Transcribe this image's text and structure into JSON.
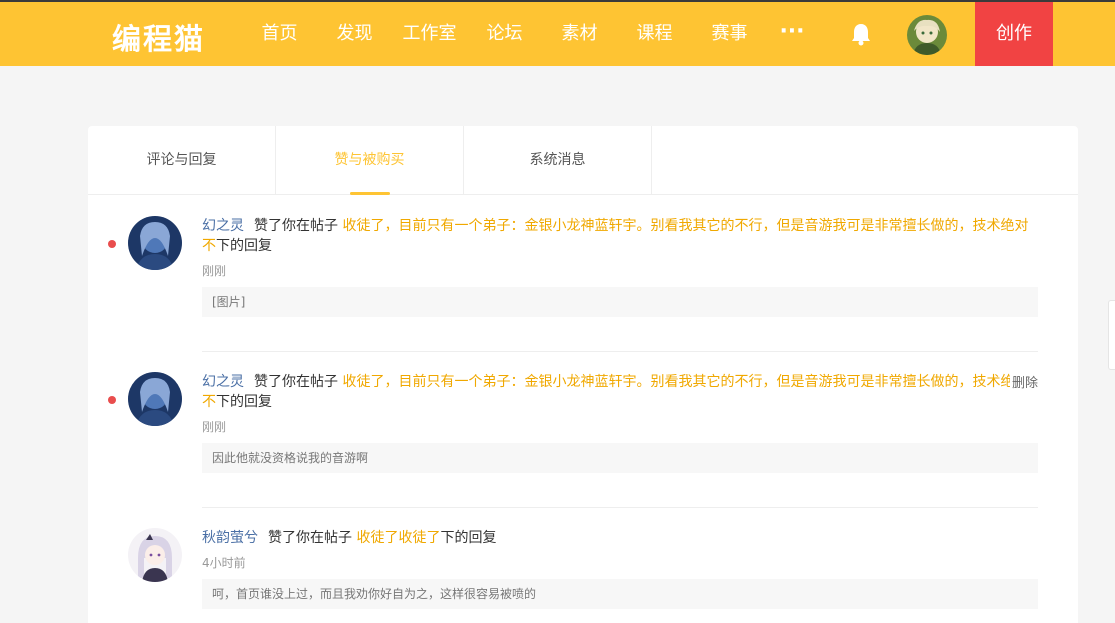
{
  "header": {
    "logo": "编程猫",
    "nav": [
      "首页",
      "发现",
      "工作室",
      "论坛",
      "素材",
      "课程",
      "赛事"
    ],
    "more": "···",
    "create": "创作",
    "colors": {
      "brand": "#fec433",
      "create": "#f14343"
    }
  },
  "tabs": [
    {
      "label": "评论与回复"
    },
    {
      "label": "赞与被购买"
    },
    {
      "label": "系统消息"
    }
  ],
  "notifications": [
    {
      "user": "幻之灵",
      "action": "赞了你在帖子",
      "post": "收徒了，目前只有一个弟子：金银小龙神蓝轩宇。别看我其它的不行，但是音游我可是非常擅长做的，技术绝对不",
      "suffix": "下的回复",
      "time": "刚刚",
      "quote": "[图片]",
      "unread": true
    },
    {
      "user": "幻之灵",
      "action": "赞了你在帖子",
      "post": "收徒了，目前只有一个弟子：金银小龙神蓝轩宇。别看我其它的不行，但是音游我可是非常擅长做的，技术绝对不",
      "suffix": "下的回复",
      "time": "刚刚",
      "quote": "因此他就没资格说我的音游啊",
      "unread": true,
      "delete_label": "删除"
    },
    {
      "user": "秋韵萤兮",
      "action": "赞了你在帖子",
      "post": "收徒了收徒了",
      "suffix": "下的回复",
      "time": "4小时前",
      "quote": "呵，首页谁没上过，而且我劝你好自为之，这样很容易被喷的",
      "unread": false
    }
  ]
}
